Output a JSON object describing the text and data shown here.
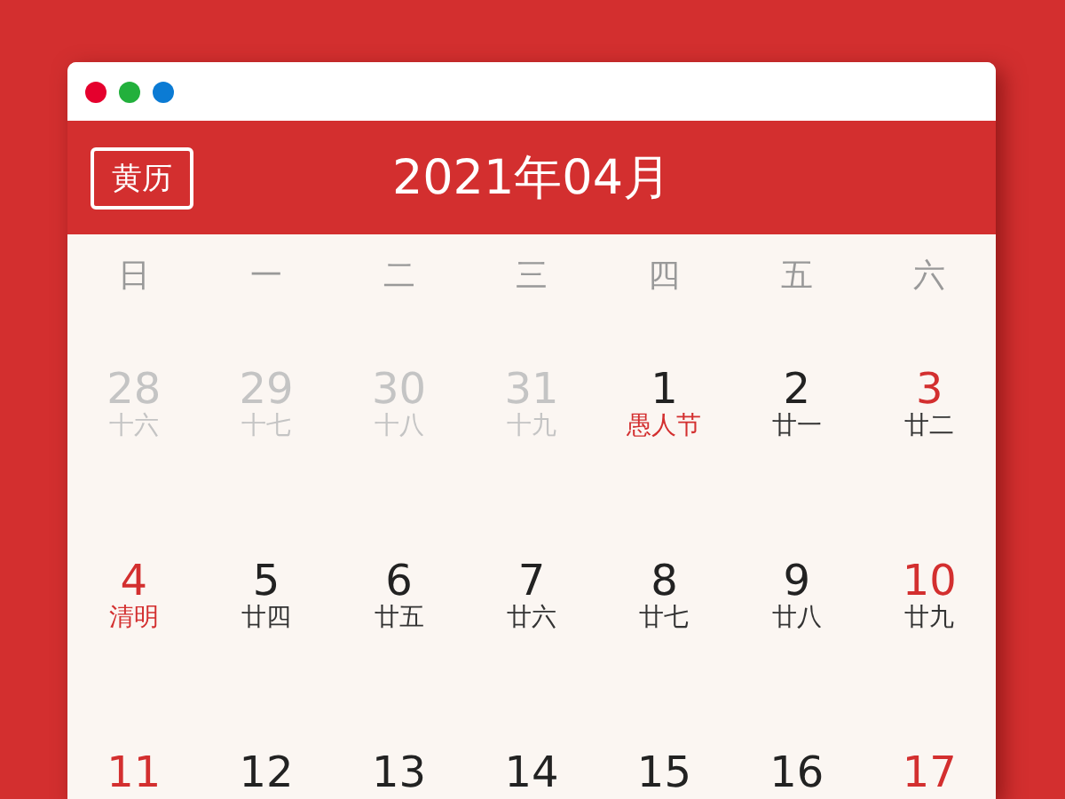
{
  "window": {
    "controls": [
      {
        "color": "#e5002d"
      },
      {
        "color": "#22b03c"
      },
      {
        "color": "#0b7bd4"
      }
    ]
  },
  "header": {
    "button": "黄历",
    "title": "2021年04月"
  },
  "weekdays": [
    "日",
    "一",
    "二",
    "三",
    "四",
    "五",
    "六"
  ],
  "weeks": [
    [
      {
        "day": "28",
        "kind": "other",
        "lunar": {
          "text": "十六",
          "kind": "faded"
        }
      },
      {
        "day": "29",
        "kind": "other",
        "lunar": {
          "text": "十七",
          "kind": "faded"
        }
      },
      {
        "day": "30",
        "kind": "other",
        "lunar": {
          "text": "十八",
          "kind": "faded"
        }
      },
      {
        "day": "31",
        "kind": "other",
        "lunar": {
          "text": "十九",
          "kind": "faded"
        }
      },
      {
        "day": "1",
        "kind": "weekday",
        "lunar": {
          "text": "愚人节",
          "kind": "festival"
        }
      },
      {
        "day": "2",
        "kind": "weekday",
        "lunar": {
          "text": "廿一",
          "kind": "plain"
        }
      },
      {
        "day": "3",
        "kind": "weekend",
        "lunar": {
          "text": "廿二",
          "kind": "plain"
        }
      }
    ],
    [
      {
        "day": "4",
        "kind": "weekend",
        "lunar": {
          "text": "清明",
          "kind": "festival"
        }
      },
      {
        "day": "5",
        "kind": "weekday",
        "lunar": {
          "text": "廿四",
          "kind": "plain"
        }
      },
      {
        "day": "6",
        "kind": "weekday",
        "lunar": {
          "text": "廿五",
          "kind": "plain"
        }
      },
      {
        "day": "7",
        "kind": "weekday",
        "lunar": {
          "text": "廿六",
          "kind": "plain"
        }
      },
      {
        "day": "8",
        "kind": "weekday",
        "lunar": {
          "text": "廿七",
          "kind": "plain"
        }
      },
      {
        "day": "9",
        "kind": "weekday",
        "lunar": {
          "text": "廿八",
          "kind": "plain"
        }
      },
      {
        "day": "10",
        "kind": "weekend",
        "lunar": {
          "text": "廿九",
          "kind": "plain"
        }
      }
    ],
    [
      {
        "day": "11",
        "kind": "weekend"
      },
      {
        "day": "12",
        "kind": "weekday"
      },
      {
        "day": "13",
        "kind": "weekday"
      },
      {
        "day": "14",
        "kind": "weekday"
      },
      {
        "day": "15",
        "kind": "weekday"
      },
      {
        "day": "16",
        "kind": "weekday"
      },
      {
        "day": "17",
        "kind": "weekend"
      }
    ]
  ]
}
